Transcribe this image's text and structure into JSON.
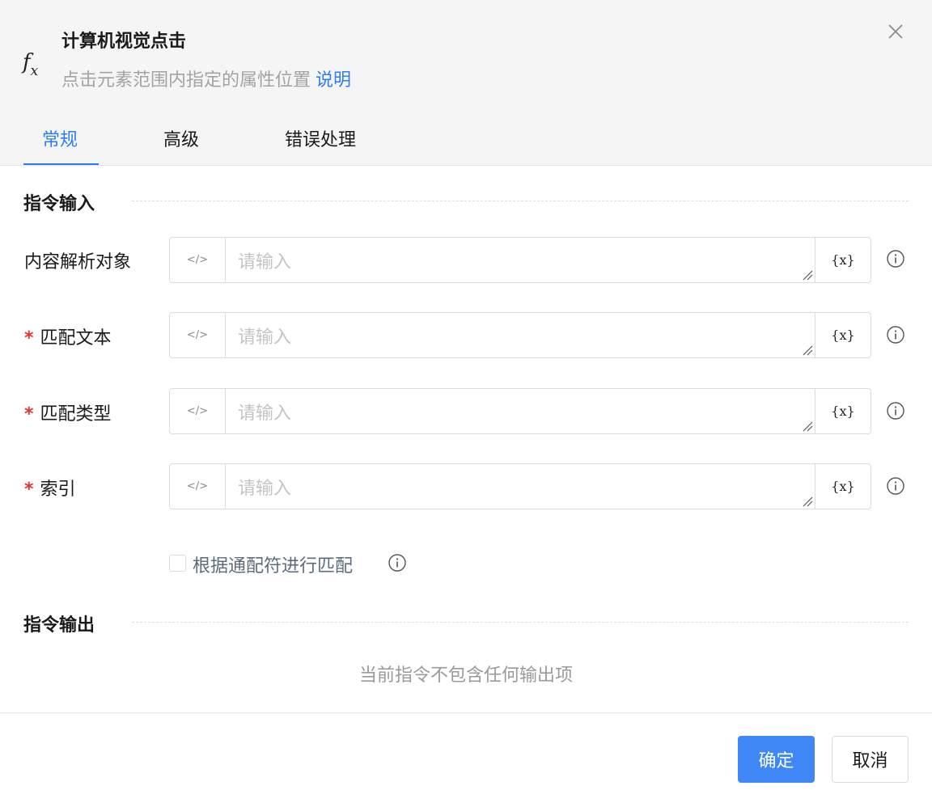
{
  "dialog": {
    "title": "计算机视觉点击",
    "description": "点击元素范围内指定的属性位置",
    "help_link": "说明",
    "icon": "fx-icon"
  },
  "tabs": [
    {
      "label": "常规",
      "active": true
    },
    {
      "label": "高级",
      "active": false
    },
    {
      "label": "错误处理",
      "active": false
    }
  ],
  "input_section": {
    "title": "指令输入",
    "fields": [
      {
        "label": "内容解析对象",
        "required": false,
        "placeholder": "请输入",
        "value": ""
      },
      {
        "label": "匹配文本",
        "required": true,
        "placeholder": "请输入",
        "value": ""
      },
      {
        "label": "匹配类型",
        "required": true,
        "placeholder": "请输入",
        "value": ""
      },
      {
        "label": "索引",
        "required": true,
        "placeholder": "请输入",
        "value": ""
      }
    ],
    "code_button_symbol": "</>",
    "variable_button_symbol": "{x}",
    "required_mark": "*",
    "wildcard_checkbox": {
      "label": "根据通配符进行匹配",
      "checked": false
    }
  },
  "output_section": {
    "title": "指令输出",
    "empty_message": "当前指令不包含任何输出项"
  },
  "footer": {
    "confirm_label": "确定",
    "cancel_label": "取消"
  },
  "colors": {
    "accent": "#2f7ef0",
    "primary_button": "#3f86f6",
    "required": "#e8322d"
  }
}
